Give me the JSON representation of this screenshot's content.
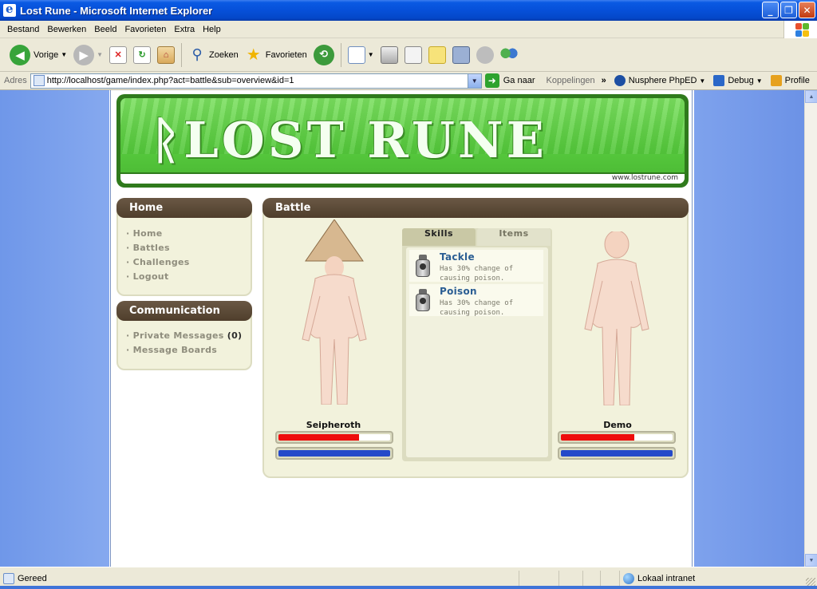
{
  "window": {
    "title": "Lost Rune - Microsoft Internet Explorer",
    "controls": {
      "minimize": "_",
      "maximize": "❐",
      "close": "✕"
    }
  },
  "menu": [
    "Bestand",
    "Bewerken",
    "Beeld",
    "Favorieten",
    "Extra",
    "Help"
  ],
  "toolbar": {
    "back": "Vorige",
    "search": "Zoeken",
    "favorites": "Favorieten"
  },
  "address": {
    "label": "Adres",
    "url": "http://localhost/game/index.php?act=battle&sub=overview&id=1",
    "go": "Ga naar",
    "links_label": "Koppelingen",
    "links": [
      "Nusphere PhpED",
      "Debug",
      "Profile"
    ]
  },
  "site": {
    "logo": "ᚱLOST RUNE",
    "banner_url": "www.lostrune.com"
  },
  "sidebar": {
    "home_panel": {
      "title": "Home",
      "items": [
        "Home",
        "Battles",
        "Challenges",
        "Logout"
      ]
    },
    "comm_panel": {
      "title": "Communication",
      "private_messages": "Private Messages",
      "pm_count": "(0)",
      "message_boards": "Message Boards"
    }
  },
  "battle": {
    "title": "Battle",
    "tabs": {
      "skills": "Skills",
      "items": "Items"
    },
    "skills": [
      {
        "name": "Tackle",
        "description": "Has 30% change of causing poison."
      },
      {
        "name": "Poison",
        "description": "Has 30% change of causing poison."
      }
    ],
    "player": {
      "name": "Seipheroth",
      "hp_fraction": 0.72,
      "mp_fraction": 1.0
    },
    "opponent": {
      "name": "Demo",
      "hp_fraction": 0.66,
      "mp_fraction": 1.0
    }
  },
  "status": {
    "text": "Gereed",
    "zone": "Lokaal intranet"
  },
  "colors": {
    "panel_head": "#5b4937",
    "panel_bg": "#f2f2dc",
    "hp": "#ee0c0c",
    "mp": "#2449c9",
    "skill_name": "#2a5d93",
    "banner_green": "#56c93d"
  }
}
